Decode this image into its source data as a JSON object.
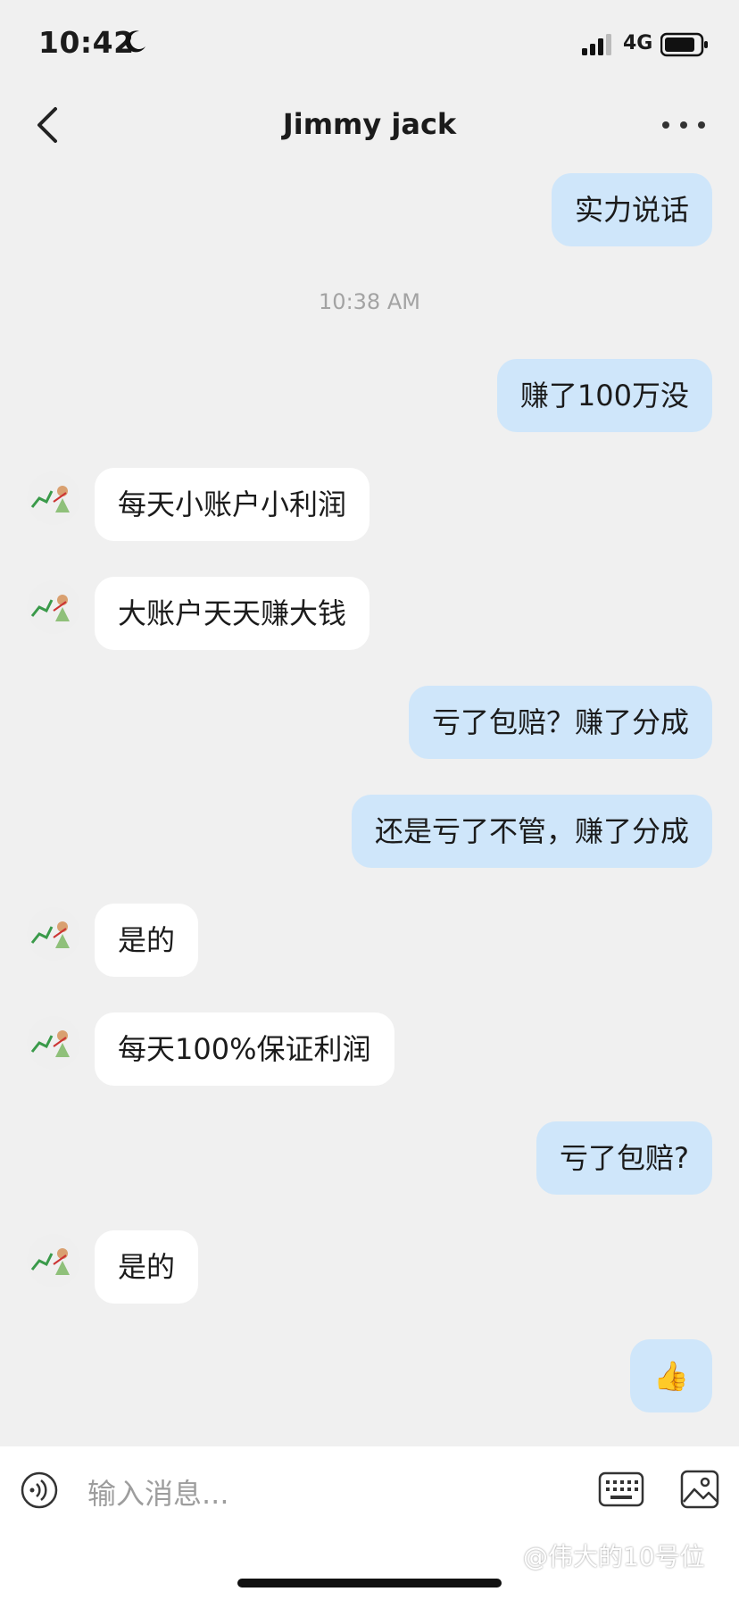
{
  "status": {
    "time": "10:42",
    "network": "4G"
  },
  "header": {
    "title": "Jimmy jack"
  },
  "messages": [
    {
      "dir": "out",
      "text": "实力说话"
    },
    {
      "dir": "ts",
      "text": "10:38 AM"
    },
    {
      "dir": "out",
      "text": "赚了100万没"
    },
    {
      "dir": "in",
      "text": "每天小账户小利润"
    },
    {
      "dir": "in",
      "text": "大账户天天赚大钱"
    },
    {
      "dir": "out",
      "text": "亏了包赔？赚了分成"
    },
    {
      "dir": "out",
      "text": "还是亏了不管，赚了分成"
    },
    {
      "dir": "in",
      "text": "是的"
    },
    {
      "dir": "in",
      "text": "每天100%保证利润"
    },
    {
      "dir": "out",
      "text": "亏了包赔?"
    },
    {
      "dir": "in",
      "text": "是的"
    },
    {
      "dir": "out",
      "text": "👍"
    }
  ],
  "input": {
    "placeholder": "输入消息..."
  },
  "watermark": "@伟大的10号位",
  "colors": {
    "outgoing_bubble": "#cfe6fa",
    "incoming_bubble": "#ffffff",
    "background": "#f0f0f0"
  },
  "icons": {
    "back": "chevron-left-icon",
    "more": "more-dots-icon",
    "voice": "voice-icon",
    "keyboard": "keyboard-icon",
    "image": "image-icon",
    "moon": "moon-icon"
  }
}
